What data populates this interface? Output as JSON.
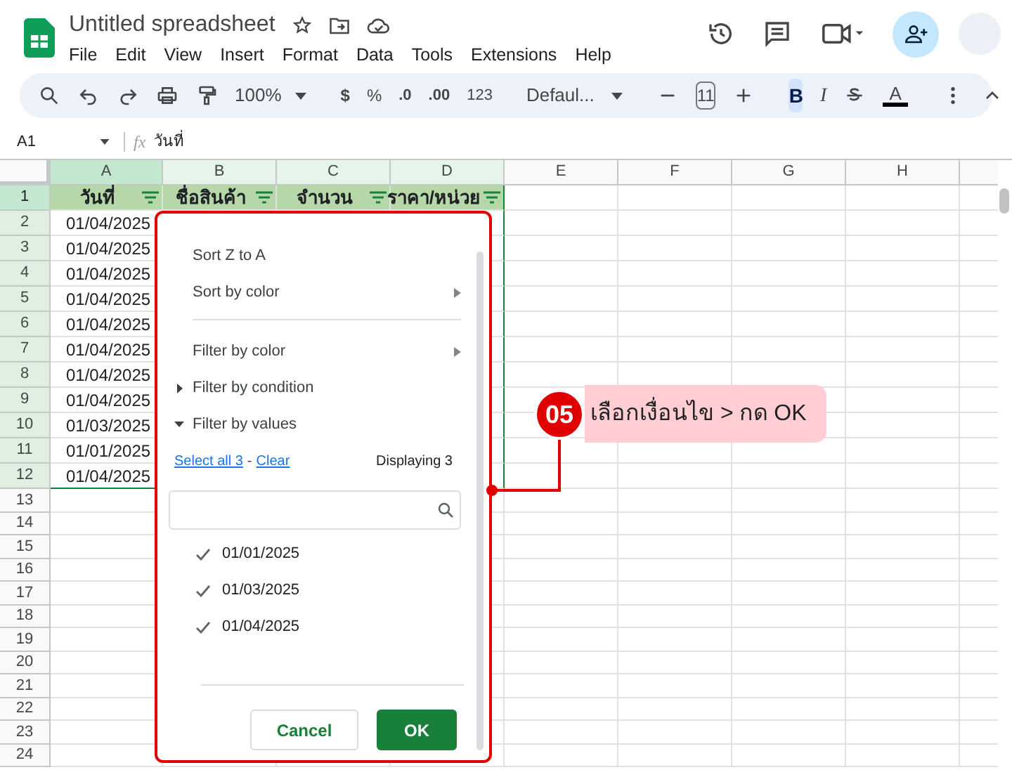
{
  "header": {
    "title": "Untitled spreadsheet",
    "menu": [
      "File",
      "Edit",
      "View",
      "Insert",
      "Format",
      "Data",
      "Tools",
      "Extensions",
      "Help"
    ]
  },
  "toolbar": {
    "zoom": "100%",
    "currency": "$",
    "percent": "%",
    "decrease_decimal": ".0",
    "increase_decimal": ".00",
    "number_format": "123",
    "font": "Defaul...",
    "font_size": "11",
    "bold": {
      "label": "B",
      "selected": true
    },
    "italic": {
      "label": "I",
      "selected": false
    },
    "text_color": {
      "label": "A",
      "color": "#000000"
    }
  },
  "formula_bar": {
    "cell": "A1",
    "function_label": "fx",
    "formula": "วันที่"
  },
  "columns": [
    {
      "letter": "A",
      "selected": true,
      "in_filter": true
    },
    {
      "letter": "B",
      "selected": false,
      "in_filter": true
    },
    {
      "letter": "C",
      "selected": false,
      "in_filter": true
    },
    {
      "letter": "D",
      "selected": false,
      "in_filter": true
    },
    {
      "letter": "E",
      "selected": false,
      "in_filter": false
    },
    {
      "letter": "F",
      "selected": false,
      "in_filter": false
    },
    {
      "letter": "G",
      "selected": false,
      "in_filter": false
    },
    {
      "letter": "H",
      "selected": false,
      "in_filter": false
    }
  ],
  "rows": [
    {
      "num": "1",
      "selected": true,
      "in_filter": true,
      "kind": "header",
      "cells": [
        "วันที่",
        "ชื่อสินค้า",
        "จำนวน",
        "ราคา/หน่วย"
      ]
    },
    {
      "num": "2",
      "selected": false,
      "in_filter": true,
      "kind": "data",
      "cells": [
        "01/04/2025"
      ]
    },
    {
      "num": "3",
      "selected": false,
      "in_filter": true,
      "kind": "data",
      "cells": [
        "01/04/2025"
      ]
    },
    {
      "num": "4",
      "selected": false,
      "in_filter": true,
      "kind": "data",
      "cells": [
        "01/04/2025"
      ]
    },
    {
      "num": "5",
      "selected": false,
      "in_filter": true,
      "kind": "data",
      "cells": [
        "01/04/2025"
      ]
    },
    {
      "num": "6",
      "selected": false,
      "in_filter": true,
      "kind": "data",
      "cells": [
        "01/04/2025"
      ]
    },
    {
      "num": "7",
      "selected": false,
      "in_filter": true,
      "kind": "data",
      "cells": [
        "01/04/2025"
      ]
    },
    {
      "num": "8",
      "selected": false,
      "in_filter": true,
      "kind": "data",
      "cells": [
        "01/04/2025"
      ]
    },
    {
      "num": "9",
      "selected": false,
      "in_filter": true,
      "kind": "data",
      "cells": [
        "01/04/2025"
      ]
    },
    {
      "num": "10",
      "selected": false,
      "in_filter": true,
      "kind": "data",
      "cells": [
        "01/03/2025"
      ]
    },
    {
      "num": "11",
      "selected": false,
      "in_filter": true,
      "kind": "data",
      "cells": [
        "01/01/2025"
      ]
    },
    {
      "num": "12",
      "selected": false,
      "in_filter": true,
      "kind": "data",
      "cells": [
        "01/04/2025"
      ]
    },
    {
      "num": "13",
      "selected": false,
      "in_filter": false,
      "kind": "data",
      "cells": []
    },
    {
      "num": "14",
      "selected": false,
      "in_filter": false,
      "kind": "data",
      "cells": []
    },
    {
      "num": "15",
      "selected": false,
      "in_filter": false,
      "kind": "data",
      "cells": []
    },
    {
      "num": "16",
      "selected": false,
      "in_filter": false,
      "kind": "data",
      "cells": []
    },
    {
      "num": "17",
      "selected": false,
      "in_filter": false,
      "kind": "data",
      "cells": []
    },
    {
      "num": "18",
      "selected": false,
      "in_filter": false,
      "kind": "data",
      "cells": []
    },
    {
      "num": "19",
      "selected": false,
      "in_filter": false,
      "kind": "data",
      "cells": []
    },
    {
      "num": "20",
      "selected": false,
      "in_filter": false,
      "kind": "data",
      "cells": []
    },
    {
      "num": "21",
      "selected": false,
      "in_filter": false,
      "kind": "data",
      "cells": []
    },
    {
      "num": "22",
      "selected": false,
      "in_filter": false,
      "kind": "data",
      "cells": []
    },
    {
      "num": "23",
      "selected": false,
      "in_filter": false,
      "kind": "data",
      "cells": []
    },
    {
      "num": "24",
      "selected": false,
      "in_filter": false,
      "kind": "data",
      "cells": []
    }
  ],
  "filter_menu": {
    "items": [
      {
        "kind": "item",
        "label": "Sort Z to A"
      },
      {
        "kind": "submenu",
        "label": "Sort by color"
      },
      {
        "kind": "divider"
      },
      {
        "kind": "submenu",
        "label": "Filter by color"
      },
      {
        "kind": "section",
        "label": "Filter by condition",
        "expanded": false
      },
      {
        "kind": "section",
        "label": "Filter by values",
        "expanded": true
      }
    ],
    "select_all": "Select all 3",
    "separator": "-",
    "clear": "Clear",
    "displaying": "Displaying 3",
    "values": [
      {
        "label": "01/01/2025",
        "checked": true
      },
      {
        "label": "01/03/2025",
        "checked": true
      },
      {
        "label": "01/04/2025",
        "checked": true
      }
    ],
    "cancel": "Cancel",
    "ok": "OK"
  },
  "callout": {
    "step": "05",
    "text": "เลือกเงื่อนไข > กด OK"
  }
}
